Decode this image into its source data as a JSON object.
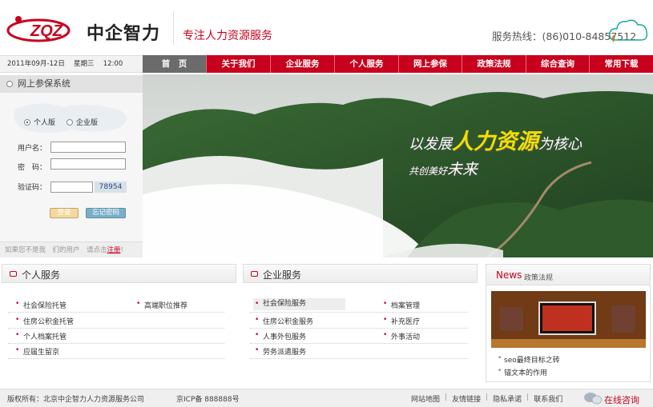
{
  "header": {
    "logo_text": "ZQZ",
    "site_name": "中企智力",
    "slogan": "专注人力资源服务",
    "hotline": "服务热线：(86)010-84857512",
    "brand_color": "#c8001e"
  },
  "datebar": {
    "date": "2011年09月-12日",
    "weekday": "星期三",
    "time": "12:00"
  },
  "nav": {
    "items": [
      "首　页",
      "关于我们",
      "企业服务",
      "个人服务",
      "网上参保",
      "政策法规",
      "综合查询",
      "常用下载"
    ]
  },
  "login": {
    "title": "网上参保系统",
    "radio_personal": "个人版",
    "radio_company": "企业版",
    "username_label": "用户名：",
    "password_label": "密　码：",
    "captcha_label": "验证码：",
    "captcha_value": "78954",
    "login_button": "登录",
    "forgot_button": "忘记密码",
    "register_tip": "如果您不是我　们的用户　请点击",
    "register_link": "注册"
  },
  "banner": {
    "line1_pre": "以发展",
    "line1_big": "人力资源",
    "line1_post": "为核心",
    "line2_pre": "共创美好",
    "line2_big": "未来"
  },
  "personal_services": {
    "title": "个人服务",
    "col1": [
      "社会保险托管",
      "住房公积金托管",
      "个人档案托管",
      "应届生留京"
    ],
    "col2": [
      "高端职位推荐"
    ]
  },
  "enterprise_services": {
    "title": "企业服务",
    "col1": [
      "社会保险服务",
      "住房公积金服务",
      "人事外包服务",
      "劳务派遣服务"
    ],
    "col2": [
      "档案管理",
      "补充医疗",
      "外事活动"
    ]
  },
  "news": {
    "title_en": "News",
    "title_zh": "政策法规",
    "items": [
      "seo最终目标之砖",
      "锚文本的作用"
    ]
  },
  "footer": {
    "copyright": "版权所有：北京中企智力人力资源服务公司",
    "icp": "京ICP备 888888号",
    "links": [
      "网站地图",
      "友情链接",
      "隐私承诺",
      "联系我们"
    ],
    "chat": "在线咨询"
  }
}
